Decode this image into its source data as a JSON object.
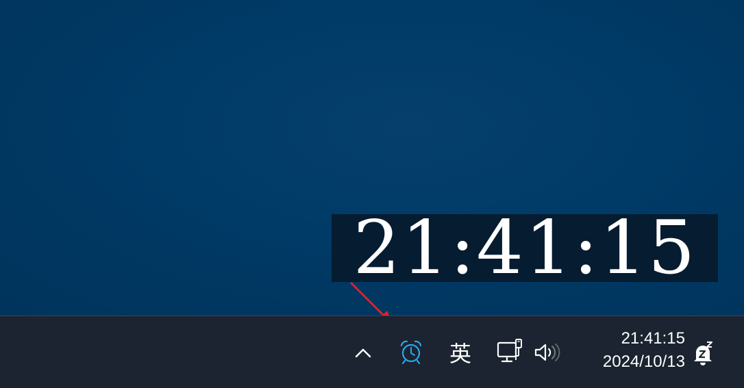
{
  "overlay_clock": {
    "time": "21:41:15"
  },
  "taskbar": {
    "tray": {
      "overflow_icon": "chevron-up-icon",
      "alarm_icon": "alarm-clock-icon",
      "ime_indicator": "英",
      "network_icon": "network-wired-icon",
      "volume_icon": "speaker-icon",
      "notification_icon": "bell-snooze-icon"
    },
    "clock": {
      "time": "21:41:15",
      "date": "2024/10/13"
    }
  },
  "colors": {
    "desktop_background": "#003a66",
    "overlay_background": "#061c30",
    "taskbar_background": "#1b2430",
    "alarm_icon_color": "#2aa9f0",
    "arrow_color": "#e0202a"
  }
}
